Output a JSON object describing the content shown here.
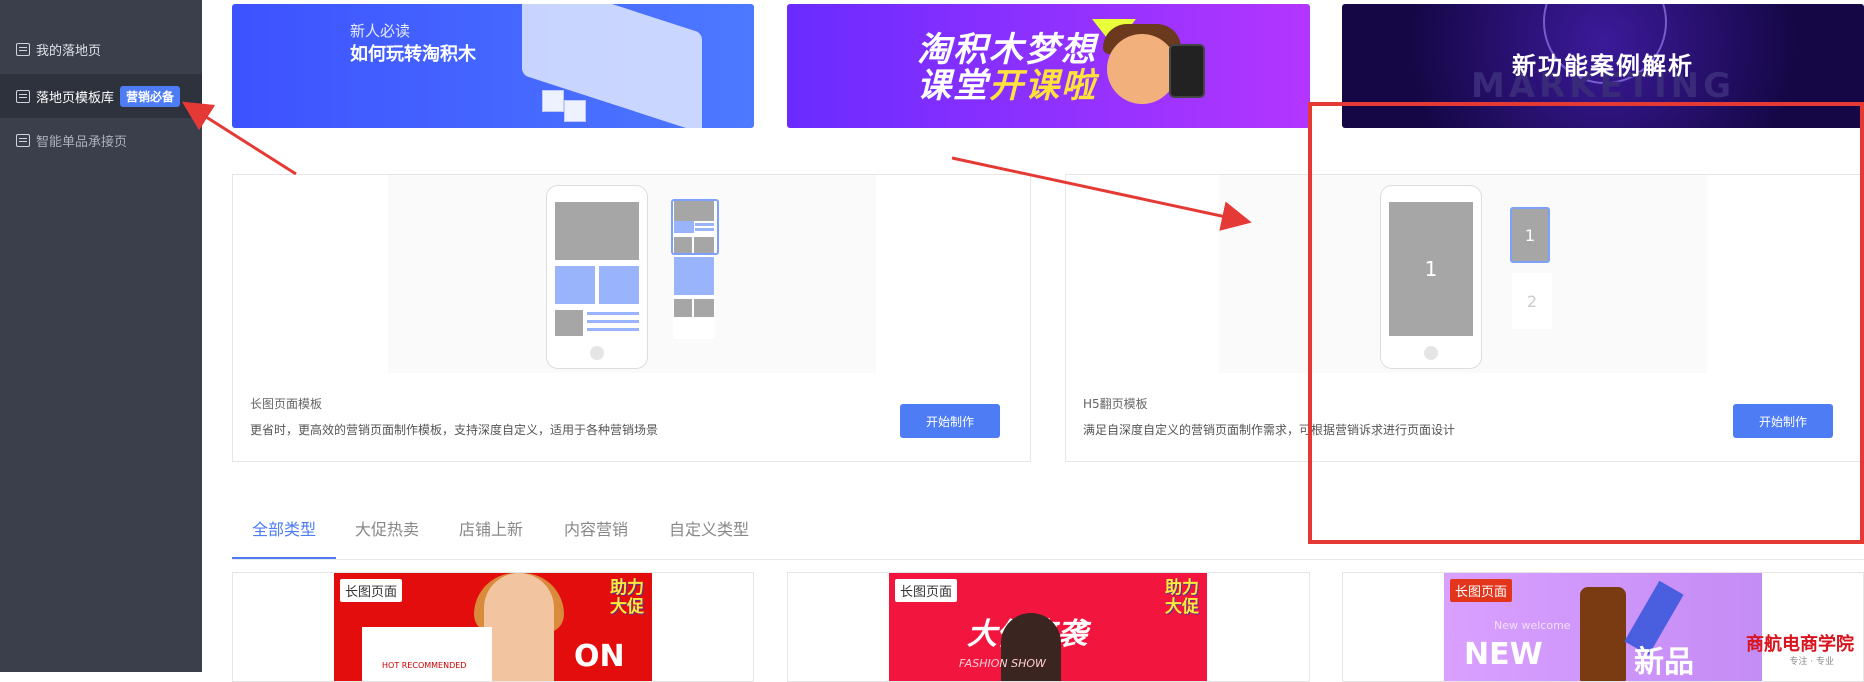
{
  "sidebar": {
    "items": [
      {
        "label": "我的落地页"
      },
      {
        "label": "落地页模板库",
        "badge": "营销必备"
      },
      {
        "label": "智能单品承接页"
      }
    ]
  },
  "banners": [
    {
      "line1": "新人必读",
      "line2": "如何玩转淘积木"
    },
    {
      "line1": "淘积木梦想",
      "line2a": "课堂",
      "line2b": "开课啦"
    },
    {
      "title": "新功能案例解析",
      "backdrop": "MARKETING"
    }
  ],
  "templates": [
    {
      "title": "长图页面模板",
      "desc": "更省时，更高效的营销页面制作模板，支持深度自定义，适用于各种营销场景",
      "button": "开始制作"
    },
    {
      "title": "H5翻页模板",
      "desc": "满足自深度自定义的营销页面制作需求，可根据营销诉求进行页面设计",
      "button": "开始制作",
      "page1": "1",
      "page2": "2"
    }
  ],
  "tabs": [
    "全部类型",
    "大促热卖",
    "店铺上新",
    "内容营销",
    "自定义类型"
  ],
  "thumbs": [
    {
      "label": "长图页面",
      "promo1": "助力",
      "promo2": "大促",
      "big": "ON",
      "small": "HOT RECOMMENDED"
    },
    {
      "label": "长图页面",
      "promo1": "助力",
      "promo2": "大促",
      "big": "大促来袭",
      "small": "FASHION SHOW"
    },
    {
      "label": "长图页面",
      "big": "NEW",
      "big2": "新品",
      "small": "New welcome"
    }
  ],
  "watermark": {
    "text": "商航电商学院",
    "sub": "专注 · 专业"
  },
  "colors": {
    "accent": "#4d7cf5",
    "sidebar": "#3a3f4b",
    "annotation": "#e53935"
  }
}
